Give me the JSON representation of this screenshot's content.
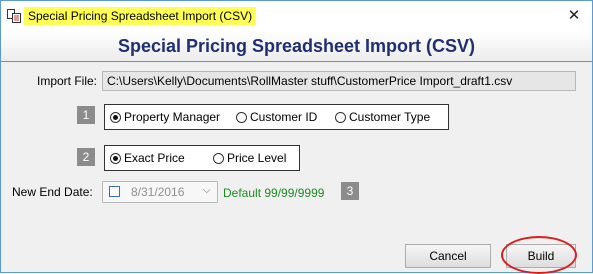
{
  "window": {
    "title": "Special Pricing Spreadsheet Import (CSV)",
    "close_label": "✕"
  },
  "header": {
    "title": "Special Pricing Spreadsheet Import (CSV)"
  },
  "import_file": {
    "label": "Import File:",
    "value": "C:\\Users\\Kelly\\Documents\\RollMaster stuff\\CustomerPrice Import_draft1.csv"
  },
  "step1": {
    "number": "1",
    "options": [
      "Property Manager",
      "Customer ID",
      "Customer Type"
    ],
    "selected": "Property Manager"
  },
  "step2": {
    "number": "2",
    "options": [
      "Exact Price",
      "Price Level"
    ],
    "selected": "Exact Price"
  },
  "end_date": {
    "label": "New End Date:",
    "value": "8/31/2016",
    "checked": false,
    "default_note": "Default 99/99/9999",
    "step_number": "3"
  },
  "buttons": {
    "cancel": "Cancel",
    "build": "Build"
  },
  "colors": {
    "title_highlight": "#ffff55",
    "header_text": "#1f2f73",
    "default_note": "#1f8a24",
    "annotation_circle": "#d81e1e",
    "window_border": "#5b9bd5"
  }
}
